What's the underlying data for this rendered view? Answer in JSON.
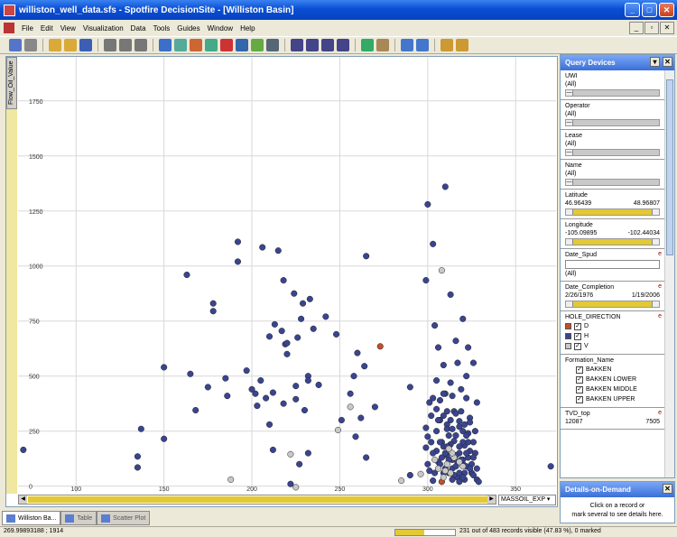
{
  "window": {
    "title": "williston_well_data.sfs - Spotfire DecisionSite - [Williston Basin]",
    "min": "_",
    "max": "□",
    "close": "✕"
  },
  "menu": [
    "File",
    "Edit",
    "View",
    "Visualization",
    "Data",
    "Tools",
    "Guides",
    "Window",
    "Help"
  ],
  "mdi": {
    "min": "_",
    "restore": "▫",
    "close": "✕"
  },
  "toolbar_icons": [
    "view-icon",
    "home-icon",
    "open-icon",
    "open2-icon",
    "save-icon",
    "cut-icon",
    "copy-icon",
    "paste-icon",
    "scatter-icon",
    "scatter3d-icon",
    "bar-icon",
    "pie-icon",
    "line-icon",
    "profile-icon",
    "heatmap-icon",
    "table-icon",
    "layout1-icon",
    "layout2-icon",
    "layout3-icon",
    "layout4-icon",
    "tool1-icon",
    "tool2-icon",
    "chart-icon",
    "chart2-icon",
    "bag1-icon",
    "bag2-icon"
  ],
  "colors": {
    "D": "#c0502c",
    "H": "#3a4590",
    "V": "#c8c8c8"
  },
  "plot": {
    "y_property": "Flow_Oil_Value",
    "x_property": "MASSOIL_EXP ▾"
  },
  "chart_data": {
    "type": "scatter",
    "xlim": [
      67,
      373
    ],
    "ylim": [
      -30,
      1950
    ],
    "xticks": [
      100,
      150,
      200,
      250,
      300,
      350
    ],
    "yticks": [
      0,
      250,
      500,
      750,
      1000,
      1250,
      1500,
      1750
    ],
    "grid": true,
    "series": [
      {
        "name": "H",
        "color": "#3a4590",
        "points": [
          [
            70,
            165
          ],
          [
            135,
            85
          ],
          [
            135,
            135
          ],
          [
            137,
            260
          ],
          [
            150,
            540
          ],
          [
            150,
            215
          ],
          [
            163,
            960
          ],
          [
            165,
            510
          ],
          [
            168,
            345
          ],
          [
            175,
            450
          ],
          [
            178,
            830
          ],
          [
            178,
            795
          ],
          [
            185,
            490
          ],
          [
            186,
            410
          ],
          [
            192,
            1110
          ],
          [
            192,
            1020
          ],
          [
            197,
            525
          ],
          [
            200,
            440
          ],
          [
            202,
            420
          ],
          [
            203,
            365
          ],
          [
            205,
            480
          ],
          [
            206,
            1085
          ],
          [
            208,
            400
          ],
          [
            210,
            680
          ],
          [
            210,
            280
          ],
          [
            212,
            425
          ],
          [
            212,
            165
          ],
          [
            213,
            735
          ],
          [
            215,
            1070
          ],
          [
            217,
            705
          ],
          [
            218,
            935
          ],
          [
            218,
            375
          ],
          [
            219,
            645
          ],
          [
            220,
            650
          ],
          [
            220,
            600
          ],
          [
            222,
            10
          ],
          [
            224,
            875
          ],
          [
            225,
            455
          ],
          [
            225,
            395
          ],
          [
            226,
            675
          ],
          [
            227,
            100
          ],
          [
            228,
            760
          ],
          [
            229,
            830
          ],
          [
            230,
            345
          ],
          [
            232,
            500
          ],
          [
            232,
            480
          ],
          [
            232,
            150
          ],
          [
            233,
            850
          ],
          [
            235,
            715
          ],
          [
            238,
            460
          ],
          [
            242,
            770
          ],
          [
            248,
            690
          ],
          [
            251,
            300
          ],
          [
            256,
            420
          ],
          [
            258,
            500
          ],
          [
            259,
            225
          ],
          [
            260,
            605
          ],
          [
            262,
            310
          ],
          [
            264,
            545
          ],
          [
            265,
            1045
          ],
          [
            265,
            130
          ],
          [
            270,
            360
          ],
          [
            290,
            50
          ],
          [
            290,
            450
          ],
          [
            299,
            265
          ],
          [
            299,
            175
          ],
          [
            299,
            935
          ],
          [
            300,
            1280
          ],
          [
            300,
            225
          ],
          [
            301,
            70
          ],
          [
            302,
            320
          ],
          [
            303,
            25
          ],
          [
            303,
            1100
          ],
          [
            304,
            730
          ],
          [
            305,
            160
          ],
          [
            306,
            630
          ],
          [
            306,
            110
          ],
          [
            307,
            300
          ],
          [
            308,
            200
          ],
          [
            309,
            550
          ],
          [
            309,
            60
          ],
          [
            310,
            1360
          ],
          [
            310,
            420
          ],
          [
            311,
            280
          ],
          [
            311,
            140
          ],
          [
            312,
            230
          ],
          [
            313,
            470
          ],
          [
            313,
            870
          ],
          [
            314,
            80
          ],
          [
            315,
            340
          ],
          [
            315,
            205
          ],
          [
            316,
            660
          ],
          [
            317,
            560
          ],
          [
            317,
            40
          ],
          [
            318,
            150
          ],
          [
            318,
            295
          ],
          [
            319,
            440
          ],
          [
            320,
            250
          ],
          [
            320,
            100
          ],
          [
            320,
            760
          ],
          [
            321,
            185
          ],
          [
            321,
            30
          ],
          [
            322,
            400
          ],
          [
            322,
            500
          ],
          [
            323,
            630
          ],
          [
            323,
            130
          ],
          [
            324,
            310
          ],
          [
            325,
            60
          ],
          [
            326,
            200
          ],
          [
            326,
            560
          ],
          [
            327,
            250
          ],
          [
            328,
            30
          ],
          [
            328,
            380
          ],
          [
            305,
            480
          ],
          [
            307,
            390
          ],
          [
            309,
            320
          ],
          [
            311,
            260
          ],
          [
            313,
            190
          ],
          [
            314,
            410
          ],
          [
            316,
            330
          ],
          [
            318,
            270
          ],
          [
            320,
            120
          ],
          [
            322,
            90
          ],
          [
            324,
            160
          ],
          [
            326,
            50
          ],
          [
            329,
            20
          ],
          [
            303,
            150
          ],
          [
            305,
            250
          ],
          [
            307,
            100
          ],
          [
            309,
            180
          ],
          [
            311,
            340
          ],
          [
            312,
            60
          ],
          [
            314,
            120
          ],
          [
            316,
            230
          ],
          [
            318,
            60
          ],
          [
            319,
            120
          ],
          [
            321,
            280
          ],
          [
            323,
            200
          ],
          [
            325,
            100
          ],
          [
            327,
            150
          ],
          [
            300,
            100
          ],
          [
            302,
            200
          ],
          [
            304,
            60
          ],
          [
            306,
            300
          ],
          [
            308,
            130
          ],
          [
            310,
            80
          ],
          [
            312,
            180
          ],
          [
            314,
            260
          ],
          [
            316,
            140
          ],
          [
            318,
            20
          ],
          [
            320,
            200
          ],
          [
            322,
            150
          ],
          [
            324,
            80
          ],
          [
            301,
            380
          ],
          [
            303,
            400
          ],
          [
            305,
            350
          ],
          [
            307,
            200
          ],
          [
            309,
            420
          ],
          [
            311,
            180
          ],
          [
            313,
            300
          ],
          [
            315,
            50
          ],
          [
            317,
            110
          ],
          [
            319,
            340
          ],
          [
            321,
            60
          ],
          [
            323,
            240
          ],
          [
            310,
            150
          ],
          [
            312,
            120
          ],
          [
            314,
            30
          ],
          [
            316,
            90
          ],
          [
            318,
            180
          ],
          [
            320,
            40
          ],
          [
            322,
            230
          ],
          [
            324,
            290
          ],
          [
            326,
            130
          ],
          [
            328,
            80
          ],
          [
            370,
            90
          ]
        ]
      },
      {
        "name": "D",
        "color": "#c0502c",
        "points": [
          [
            273,
            635
          ],
          [
            308,
            20
          ]
        ]
      },
      {
        "name": "V",
        "color": "#c8c8c8",
        "points": [
          [
            188,
            30
          ],
          [
            222,
            145
          ],
          [
            225,
            -5
          ],
          [
            249,
            255
          ],
          [
            256,
            360
          ],
          [
            285,
            25
          ],
          [
            296,
            55
          ],
          [
            304,
            120
          ],
          [
            306,
            80
          ],
          [
            308,
            980
          ],
          [
            309,
            40
          ],
          [
            311,
            100
          ],
          [
            313,
            60
          ],
          [
            315,
            130
          ],
          [
            312,
            170
          ],
          [
            310,
            70
          ],
          [
            314,
            150
          ],
          [
            318,
            110
          ],
          [
            320,
            90
          ]
        ]
      }
    ]
  },
  "x_scroll": {
    "left": "◀",
    "right": "▶"
  },
  "tabs": [
    "Williston Ba...",
    "Table",
    "Scatter Plot"
  ],
  "status": {
    "coord": "269.99893188 ; 1914",
    "records": "231 out of 483 records visible (47.83 %), 0 marked",
    "progress_pct": 47.83
  },
  "query_panel": {
    "title": "Query Devices",
    "pin": "▾",
    "close": "✕",
    "devices": [
      {
        "name": "UWI",
        "sub": "(All)",
        "kind": "slider"
      },
      {
        "name": "Operator",
        "sub": "(All)",
        "kind": "slider"
      },
      {
        "name": "Lease",
        "sub": "(All)",
        "kind": "slider"
      },
      {
        "name": "Name",
        "sub": "(All)",
        "kind": "slider"
      }
    ],
    "latitude": {
      "name": "Latitude",
      "min": "46.96439",
      "max": "48.96807"
    },
    "longitude": {
      "name": "Longitude",
      "min": "-105.09895",
      "max": "-102.44034"
    },
    "date_spud": {
      "name": "Date_Spud",
      "sub": "(All)",
      "e": "e"
    },
    "date_completion": {
      "name": "Date_Completion",
      "min": "2/26/1976",
      "max": "1/19/2006",
      "e": "e"
    },
    "hole_direction": {
      "name": "HOLE_DIRECTION",
      "e": "e",
      "items": [
        {
          "label": "D",
          "check": "✓"
        },
        {
          "label": "H",
          "check": "✓"
        },
        {
          "label": "V",
          "check": "✓"
        }
      ]
    },
    "formation": {
      "name": "Formation_Name",
      "items": [
        {
          "label": "BAKKEN",
          "check": "✓"
        },
        {
          "label": "BAKKEN LOWER",
          "check": "✓"
        },
        {
          "label": "BAKKEN MIDDLE",
          "check": "✓"
        },
        {
          "label": "BAKKEN UPPER",
          "check": "✓"
        }
      ]
    },
    "tvd": {
      "name": "TVD_top",
      "min": "12087",
      "max": "7505",
      "e": "e"
    }
  },
  "details_panel": {
    "title": "Details-on-Demand",
    "close": "✕",
    "text1": "Click on a record or",
    "text2": "mark several to see details here."
  }
}
